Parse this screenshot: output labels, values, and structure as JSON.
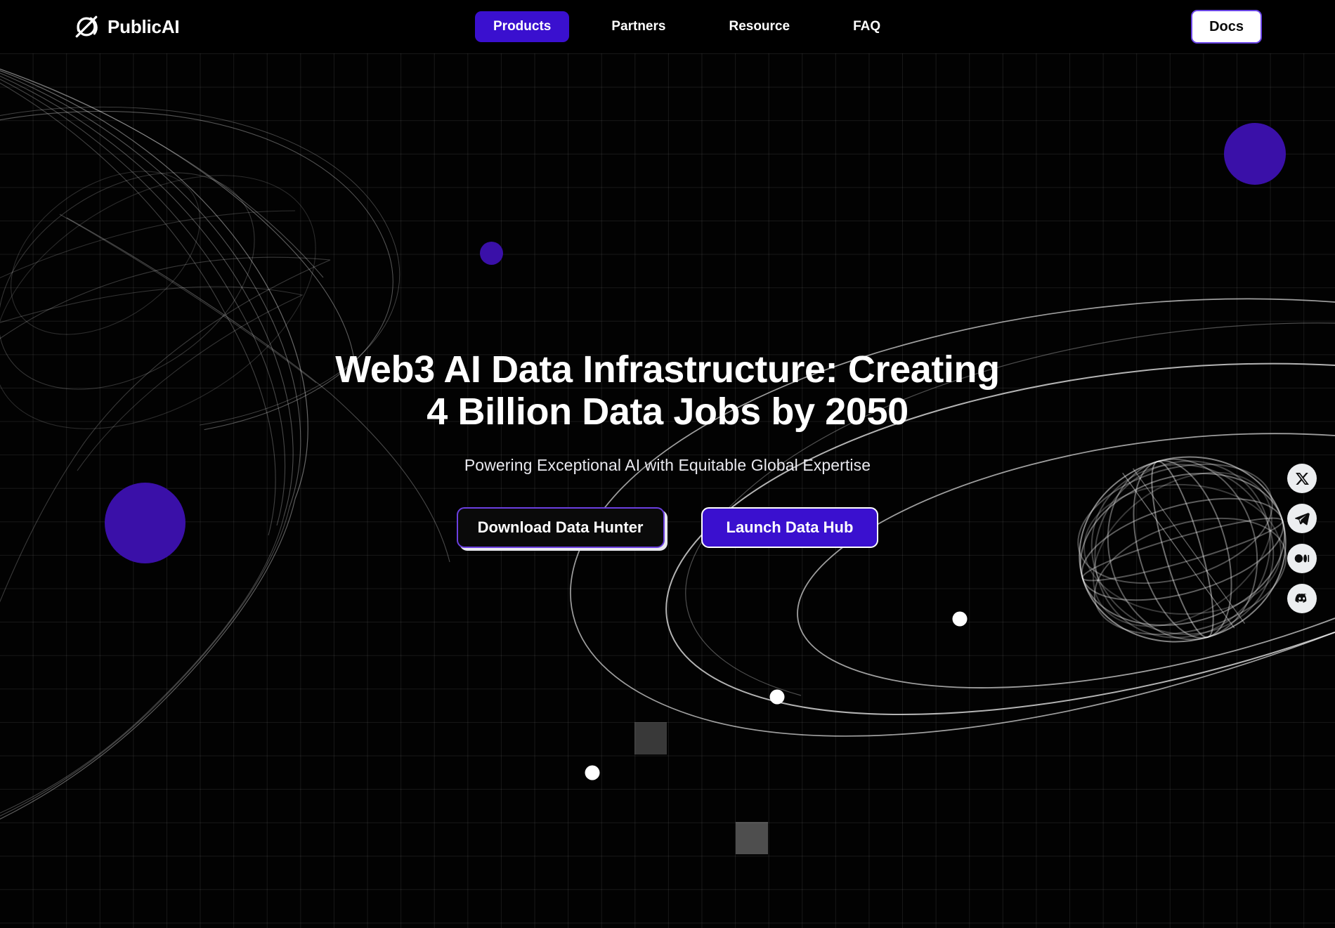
{
  "brand": {
    "name": "PublicAI",
    "logo_icon": "publicai-planet-slash-icon"
  },
  "nav": {
    "items": [
      {
        "label": "Products",
        "active": true
      },
      {
        "label": "Partners",
        "active": false
      },
      {
        "label": "Resource",
        "active": false
      },
      {
        "label": "FAQ",
        "active": false
      }
    ],
    "docs_label": "Docs"
  },
  "hero": {
    "headline": "Web3 AI Data Infrastructure: Creating 4 Billion Data Jobs by 2050",
    "subheadline": "Powering Exceptional AI with Equitable Global Expertise",
    "primary_cta": "Launch Data Hub",
    "secondary_cta": "Download Data Hunter"
  },
  "social": {
    "items": [
      {
        "name": "x-twitter",
        "label": "X"
      },
      {
        "name": "telegram",
        "label": "Telegram"
      },
      {
        "name": "medium",
        "label": "Medium"
      },
      {
        "name": "discord",
        "label": "Discord"
      }
    ]
  },
  "colors": {
    "background": "#020202",
    "accent_purple": "#3a10cf",
    "blob_purple": "#3a10a8",
    "docs_border": "#6b46e8",
    "text_primary": "#ffffff",
    "grid_line": "rgba(255,255,255,0.085)"
  }
}
